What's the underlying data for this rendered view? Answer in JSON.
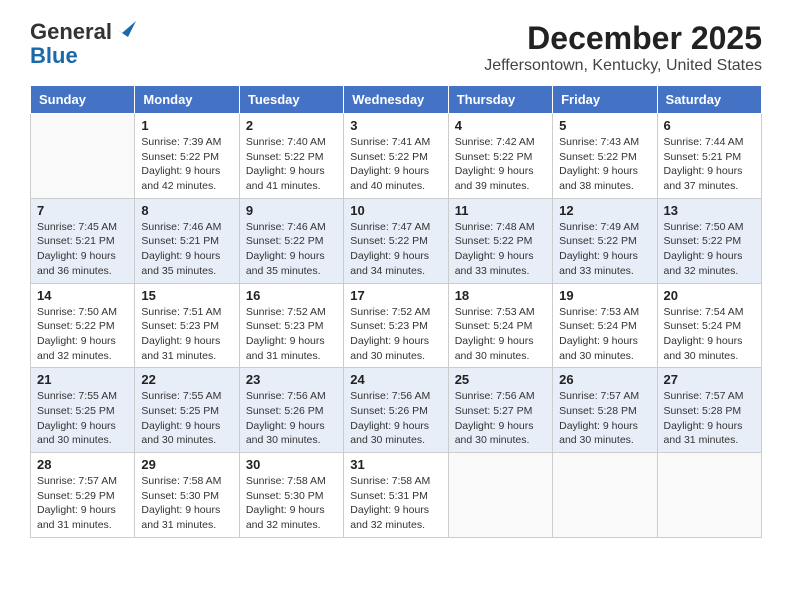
{
  "logo": {
    "general": "General",
    "blue": "Blue"
  },
  "header": {
    "month": "December 2025",
    "location": "Jeffersontown, Kentucky, United States"
  },
  "days_of_week": [
    "Sunday",
    "Monday",
    "Tuesday",
    "Wednesday",
    "Thursday",
    "Friday",
    "Saturday"
  ],
  "weeks": [
    [
      {
        "day": "",
        "sunrise": "",
        "sunset": "",
        "daylight": ""
      },
      {
        "day": "1",
        "sunrise": "Sunrise: 7:39 AM",
        "sunset": "Sunset: 5:22 PM",
        "daylight": "Daylight: 9 hours and 42 minutes."
      },
      {
        "day": "2",
        "sunrise": "Sunrise: 7:40 AM",
        "sunset": "Sunset: 5:22 PM",
        "daylight": "Daylight: 9 hours and 41 minutes."
      },
      {
        "day": "3",
        "sunrise": "Sunrise: 7:41 AM",
        "sunset": "Sunset: 5:22 PM",
        "daylight": "Daylight: 9 hours and 40 minutes."
      },
      {
        "day": "4",
        "sunrise": "Sunrise: 7:42 AM",
        "sunset": "Sunset: 5:22 PM",
        "daylight": "Daylight: 9 hours and 39 minutes."
      },
      {
        "day": "5",
        "sunrise": "Sunrise: 7:43 AM",
        "sunset": "Sunset: 5:22 PM",
        "daylight": "Daylight: 9 hours and 38 minutes."
      },
      {
        "day": "6",
        "sunrise": "Sunrise: 7:44 AM",
        "sunset": "Sunset: 5:21 PM",
        "daylight": "Daylight: 9 hours and 37 minutes."
      }
    ],
    [
      {
        "day": "7",
        "sunrise": "Sunrise: 7:45 AM",
        "sunset": "Sunset: 5:21 PM",
        "daylight": "Daylight: 9 hours and 36 minutes."
      },
      {
        "day": "8",
        "sunrise": "Sunrise: 7:46 AM",
        "sunset": "Sunset: 5:21 PM",
        "daylight": "Daylight: 9 hours and 35 minutes."
      },
      {
        "day": "9",
        "sunrise": "Sunrise: 7:46 AM",
        "sunset": "Sunset: 5:22 PM",
        "daylight": "Daylight: 9 hours and 35 minutes."
      },
      {
        "day": "10",
        "sunrise": "Sunrise: 7:47 AM",
        "sunset": "Sunset: 5:22 PM",
        "daylight": "Daylight: 9 hours and 34 minutes."
      },
      {
        "day": "11",
        "sunrise": "Sunrise: 7:48 AM",
        "sunset": "Sunset: 5:22 PM",
        "daylight": "Daylight: 9 hours and 33 minutes."
      },
      {
        "day": "12",
        "sunrise": "Sunrise: 7:49 AM",
        "sunset": "Sunset: 5:22 PM",
        "daylight": "Daylight: 9 hours and 33 minutes."
      },
      {
        "day": "13",
        "sunrise": "Sunrise: 7:50 AM",
        "sunset": "Sunset: 5:22 PM",
        "daylight": "Daylight: 9 hours and 32 minutes."
      }
    ],
    [
      {
        "day": "14",
        "sunrise": "Sunrise: 7:50 AM",
        "sunset": "Sunset: 5:22 PM",
        "daylight": "Daylight: 9 hours and 32 minutes."
      },
      {
        "day": "15",
        "sunrise": "Sunrise: 7:51 AM",
        "sunset": "Sunset: 5:23 PM",
        "daylight": "Daylight: 9 hours and 31 minutes."
      },
      {
        "day": "16",
        "sunrise": "Sunrise: 7:52 AM",
        "sunset": "Sunset: 5:23 PM",
        "daylight": "Daylight: 9 hours and 31 minutes."
      },
      {
        "day": "17",
        "sunrise": "Sunrise: 7:52 AM",
        "sunset": "Sunset: 5:23 PM",
        "daylight": "Daylight: 9 hours and 30 minutes."
      },
      {
        "day": "18",
        "sunrise": "Sunrise: 7:53 AM",
        "sunset": "Sunset: 5:24 PM",
        "daylight": "Daylight: 9 hours and 30 minutes."
      },
      {
        "day": "19",
        "sunrise": "Sunrise: 7:53 AM",
        "sunset": "Sunset: 5:24 PM",
        "daylight": "Daylight: 9 hours and 30 minutes."
      },
      {
        "day": "20",
        "sunrise": "Sunrise: 7:54 AM",
        "sunset": "Sunset: 5:24 PM",
        "daylight": "Daylight: 9 hours and 30 minutes."
      }
    ],
    [
      {
        "day": "21",
        "sunrise": "Sunrise: 7:55 AM",
        "sunset": "Sunset: 5:25 PM",
        "daylight": "Daylight: 9 hours and 30 minutes."
      },
      {
        "day": "22",
        "sunrise": "Sunrise: 7:55 AM",
        "sunset": "Sunset: 5:25 PM",
        "daylight": "Daylight: 9 hours and 30 minutes."
      },
      {
        "day": "23",
        "sunrise": "Sunrise: 7:56 AM",
        "sunset": "Sunset: 5:26 PM",
        "daylight": "Daylight: 9 hours and 30 minutes."
      },
      {
        "day": "24",
        "sunrise": "Sunrise: 7:56 AM",
        "sunset": "Sunset: 5:26 PM",
        "daylight": "Daylight: 9 hours and 30 minutes."
      },
      {
        "day": "25",
        "sunrise": "Sunrise: 7:56 AM",
        "sunset": "Sunset: 5:27 PM",
        "daylight": "Daylight: 9 hours and 30 minutes."
      },
      {
        "day": "26",
        "sunrise": "Sunrise: 7:57 AM",
        "sunset": "Sunset: 5:28 PM",
        "daylight": "Daylight: 9 hours and 30 minutes."
      },
      {
        "day": "27",
        "sunrise": "Sunrise: 7:57 AM",
        "sunset": "Sunset: 5:28 PM",
        "daylight": "Daylight: 9 hours and 31 minutes."
      }
    ],
    [
      {
        "day": "28",
        "sunrise": "Sunrise: 7:57 AM",
        "sunset": "Sunset: 5:29 PM",
        "daylight": "Daylight: 9 hours and 31 minutes."
      },
      {
        "day": "29",
        "sunrise": "Sunrise: 7:58 AM",
        "sunset": "Sunset: 5:30 PM",
        "daylight": "Daylight: 9 hours and 31 minutes."
      },
      {
        "day": "30",
        "sunrise": "Sunrise: 7:58 AM",
        "sunset": "Sunset: 5:30 PM",
        "daylight": "Daylight: 9 hours and 32 minutes."
      },
      {
        "day": "31",
        "sunrise": "Sunrise: 7:58 AM",
        "sunset": "Sunset: 5:31 PM",
        "daylight": "Daylight: 9 hours and 32 minutes."
      },
      {
        "day": "",
        "sunrise": "",
        "sunset": "",
        "daylight": ""
      },
      {
        "day": "",
        "sunrise": "",
        "sunset": "",
        "daylight": ""
      },
      {
        "day": "",
        "sunrise": "",
        "sunset": "",
        "daylight": ""
      }
    ]
  ]
}
